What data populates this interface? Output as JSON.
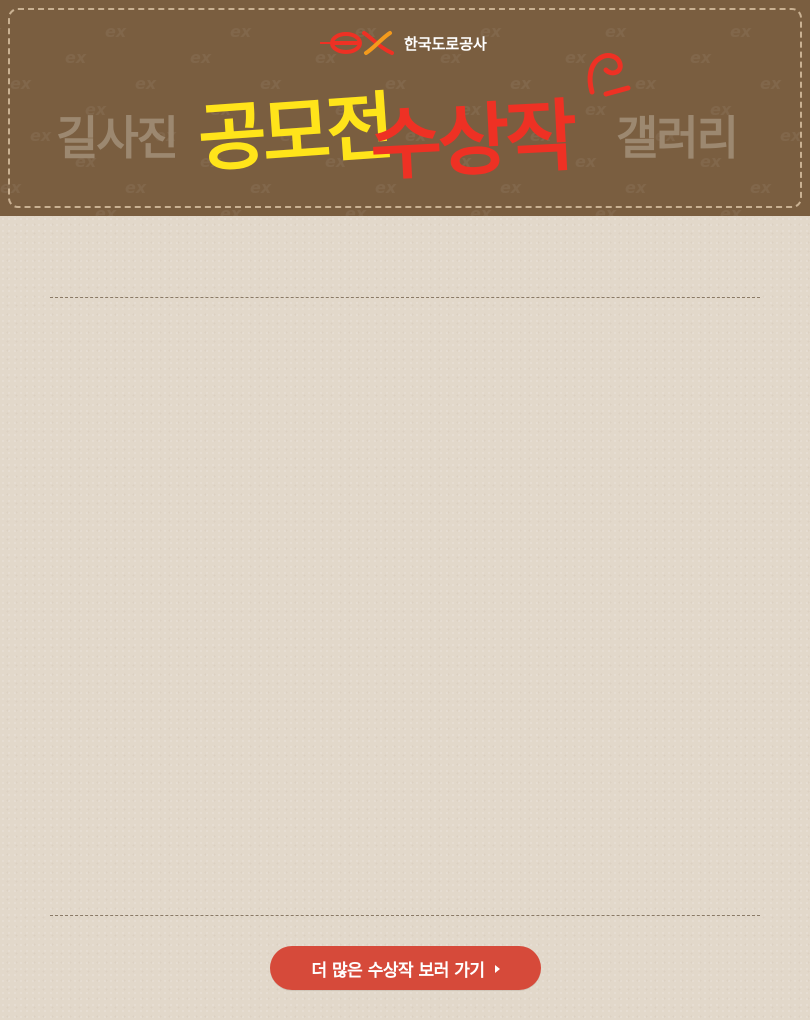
{
  "header": {
    "logo_mark": "ex",
    "logo_text": "한국도로공사",
    "title_left": "길사진",
    "title_yellow": "공모전",
    "title_red": "수상작",
    "title_right": "갤러리"
  },
  "more_button": {
    "label": "더 많은 수상작 보러 가기"
  },
  "colors": {
    "banner_bg": "#7a5e40",
    "page_bg": "#e2d8ca",
    "accent_yellow": "#ffe41a",
    "accent_red": "#ee3124",
    "button_bg": "#d64a3a",
    "side_title": "#9c8870"
  },
  "icons": {
    "logo": "ex-logo-icon",
    "button_arrow": "arrow-right-icon"
  }
}
